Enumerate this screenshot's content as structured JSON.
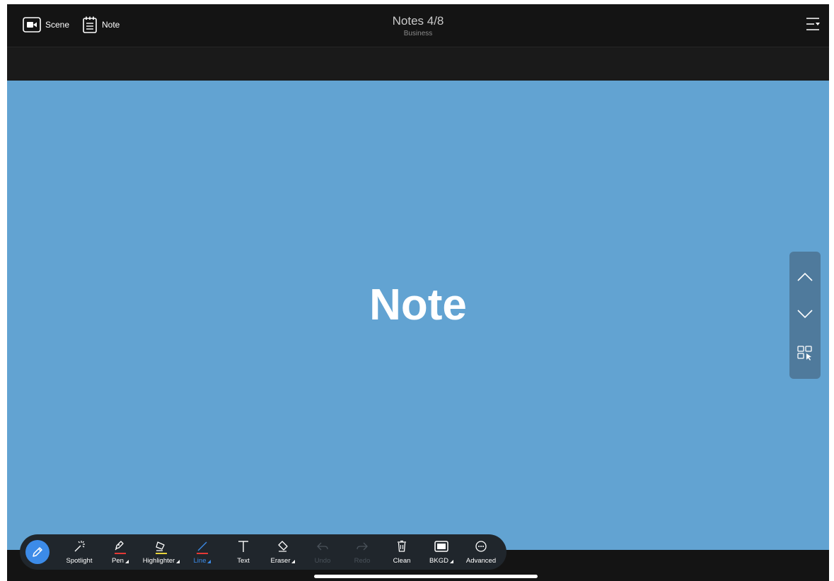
{
  "topbar": {
    "scene_label": "Scene",
    "note_label": "Note",
    "title": "Notes 4/8",
    "subtitle": "Business"
  },
  "slide": {
    "text": "Note",
    "background": "#62a3d2"
  },
  "sidenav": {
    "items": [
      "chevron-up-icon",
      "chevron-down-icon",
      "grid-select-icon"
    ]
  },
  "toolbar": {
    "tools": [
      {
        "label": "Spotlight",
        "icon": "spotlight-icon"
      },
      {
        "label": "Pen",
        "icon": "pen-icon",
        "accent": "#e53935"
      },
      {
        "label": "Highlighter",
        "icon": "highlighter-icon",
        "accent": "#e8d43a"
      },
      {
        "label": "Line",
        "icon": "line-icon",
        "accent": "#e53935",
        "active": true
      },
      {
        "label": "Text",
        "icon": "text-icon"
      },
      {
        "label": "Eraser",
        "icon": "eraser-icon"
      },
      {
        "label": "Undo",
        "icon": "undo-icon",
        "disabled": true
      },
      {
        "label": "Redo",
        "icon": "redo-icon",
        "disabled": true
      },
      {
        "label": "Clean",
        "icon": "trash-icon"
      },
      {
        "label": "BKGD",
        "icon": "background-icon"
      },
      {
        "label": "Advanced",
        "icon": "more-icon"
      }
    ],
    "accent": "#3c8be8"
  }
}
